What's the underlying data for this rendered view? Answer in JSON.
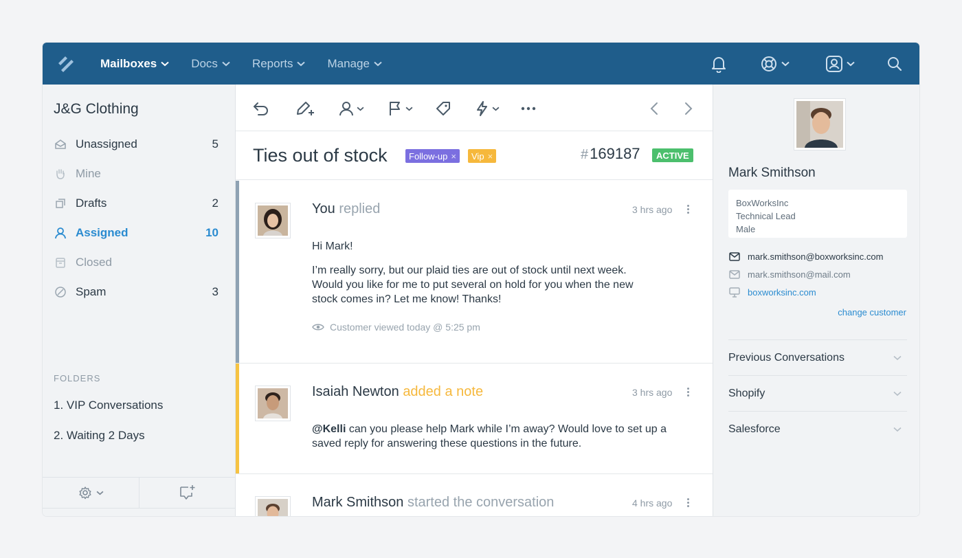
{
  "topnav": {
    "items": [
      {
        "label": "Mailboxes"
      },
      {
        "label": "Docs"
      },
      {
        "label": "Reports"
      },
      {
        "label": "Manage"
      }
    ],
    "icons": [
      "bell-icon",
      "help-icon",
      "account-icon",
      "search-icon"
    ]
  },
  "sidebar": {
    "mailbox_name": "J&G Clothing",
    "items": [
      {
        "label": "Unassigned",
        "count": "5"
      },
      {
        "label": "Mine",
        "count": ""
      },
      {
        "label": "Drafts",
        "count": "2"
      },
      {
        "label": "Assigned",
        "count": "10"
      },
      {
        "label": "Closed",
        "count": ""
      },
      {
        "label": "Spam",
        "count": "3"
      }
    ],
    "folders_label": "FOLDERS",
    "folders": [
      {
        "label": "1. VIP Conversations"
      },
      {
        "label": "2. Waiting 2 Days"
      }
    ]
  },
  "conversation": {
    "subject": "Ties out of stock",
    "tags": [
      {
        "label": "Follow-up",
        "color": "#7b6fe0"
      },
      {
        "label": "Vip",
        "color": "#f6b83c"
      }
    ],
    "number_hash": "#",
    "number": "169187",
    "status": "ACTIVE",
    "messages": [
      {
        "author": "You",
        "action": "replied",
        "time": "3 hrs ago",
        "body": [
          "Hi Mark!",
          "I’m really sorry, but our plaid ties are out of stock until next week. Would you like for me to put several on hold for you when the new stock comes in? Let me know! Thanks!"
        ],
        "viewed": "Customer viewed today @ 5:25 pm"
      },
      {
        "author": "Isaiah Newton",
        "action": "added a note",
        "time": "3 hrs ago",
        "mention": "@Kelli",
        "body": "can you please help Mark while I’m away? Would love to set up a saved reply for answering these questions in the future."
      },
      {
        "author": "Mark Smithson",
        "action": "started the conversation",
        "time": "4 hrs ago"
      }
    ]
  },
  "customer": {
    "name": "Mark Smithson",
    "company": "BoxWorksInc",
    "title": "Technical Lead",
    "gender": "Male",
    "email_primary": "mark.smithson@boxworksinc.com",
    "email_secondary": "mark.smithson@mail.com",
    "website": "boxworksinc.com",
    "change_link": "change customer",
    "sections": [
      {
        "label": "Previous Conversations"
      },
      {
        "label": "Shopify"
      },
      {
        "label": "Salesforce"
      }
    ]
  },
  "colors": {
    "nav_bg": "#1f5d8b",
    "accent": "#2a8bd0",
    "note": "#f6b83c",
    "active": "#4cbf6d"
  }
}
